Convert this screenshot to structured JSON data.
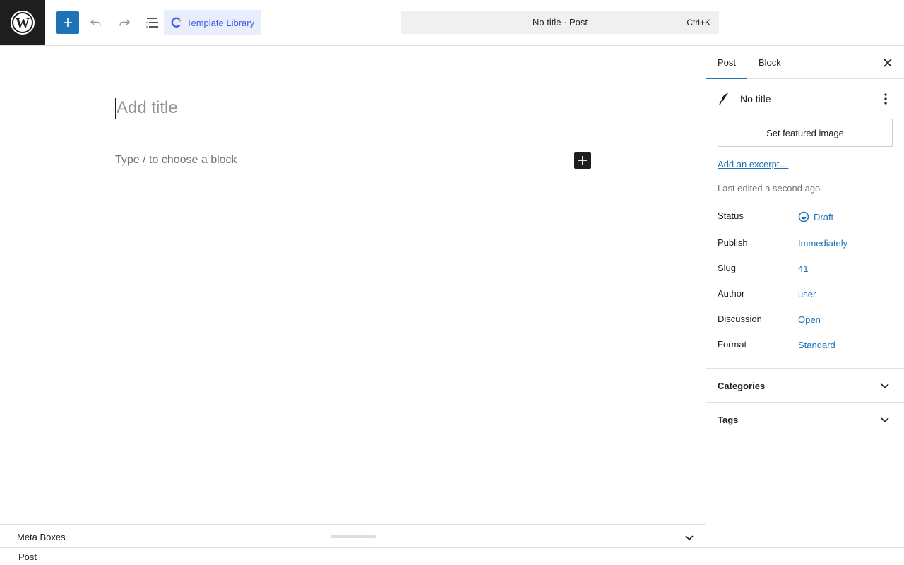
{
  "topbar": {
    "logo_icon": "wordpress-logo-icon",
    "add_block_icon": "plus-icon",
    "undo_icon": "undo-icon",
    "redo_icon": "redo-icon",
    "list_view_icon": "list-view-icon",
    "template_library_label": "Template Library",
    "command": {
      "title": "No title · Post",
      "shortcut": "Ctrl+K"
    }
  },
  "editor": {
    "title_placeholder": "Add title",
    "block_placeholder": "Type / to choose a block"
  },
  "meta_boxes": {
    "label": "Meta Boxes"
  },
  "footer": {
    "breadcrumb": "Post"
  },
  "sidebar": {
    "tabs": [
      {
        "label": "Post",
        "active": true
      },
      {
        "label": "Block",
        "active": false
      }
    ],
    "post_title": "No title",
    "featured_image_label": "Set featured image",
    "excerpt_link": "Add an excerpt…",
    "last_edited": "Last edited a second ago.",
    "rows": [
      {
        "label": "Status",
        "value": "Draft"
      },
      {
        "label": "Publish",
        "value": "Immediately"
      },
      {
        "label": "Slug",
        "value": "41"
      },
      {
        "label": "Author",
        "value": "user"
      },
      {
        "label": "Discussion",
        "value": "Open"
      },
      {
        "label": "Format",
        "value": "Standard"
      }
    ],
    "panels": [
      {
        "label": "Categories"
      },
      {
        "label": "Tags"
      }
    ]
  },
  "colors": {
    "accent": "#1d72b8",
    "template_library": "#3858e9",
    "dark": "#1e1e1e"
  }
}
